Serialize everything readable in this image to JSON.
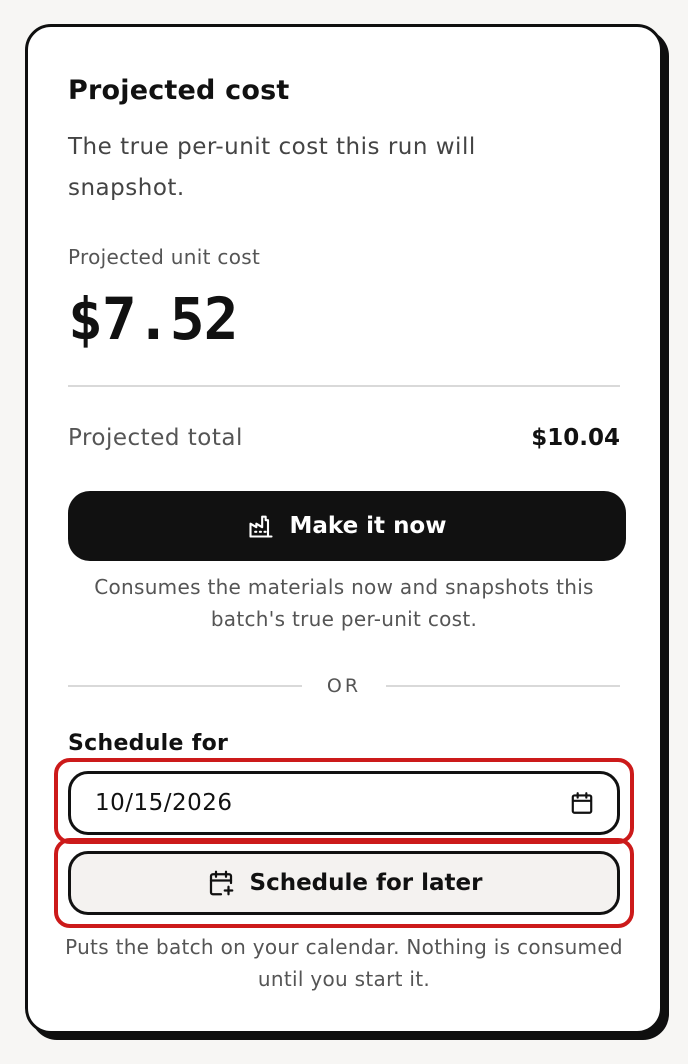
{
  "card": {
    "title": "Projected cost",
    "subtitle": "The true per-unit cost this run will snapshot.",
    "unit_cost_label": "Projected unit cost",
    "unit_cost_value": "$7.52",
    "total_label": "Projected total",
    "total_value": "$10.04"
  },
  "make_now": {
    "icon": "factory-icon",
    "label": "Make it now",
    "help": "Consumes the materials now and snapshots this batch's true per-unit cost."
  },
  "separator": {
    "label": "OR"
  },
  "schedule": {
    "label": "Schedule for",
    "date_value": "10/15/2026",
    "date_icon": "calendar-icon",
    "button_icon": "calendar-plus-icon",
    "button_label": "Schedule for later",
    "help": "Puts the batch on your calendar. Nothing is consumed until you start it."
  },
  "colors": {
    "accent": "#111111",
    "highlight": "#cc1a1a",
    "muted_text": "#555555",
    "background": "#f7f6f4"
  }
}
